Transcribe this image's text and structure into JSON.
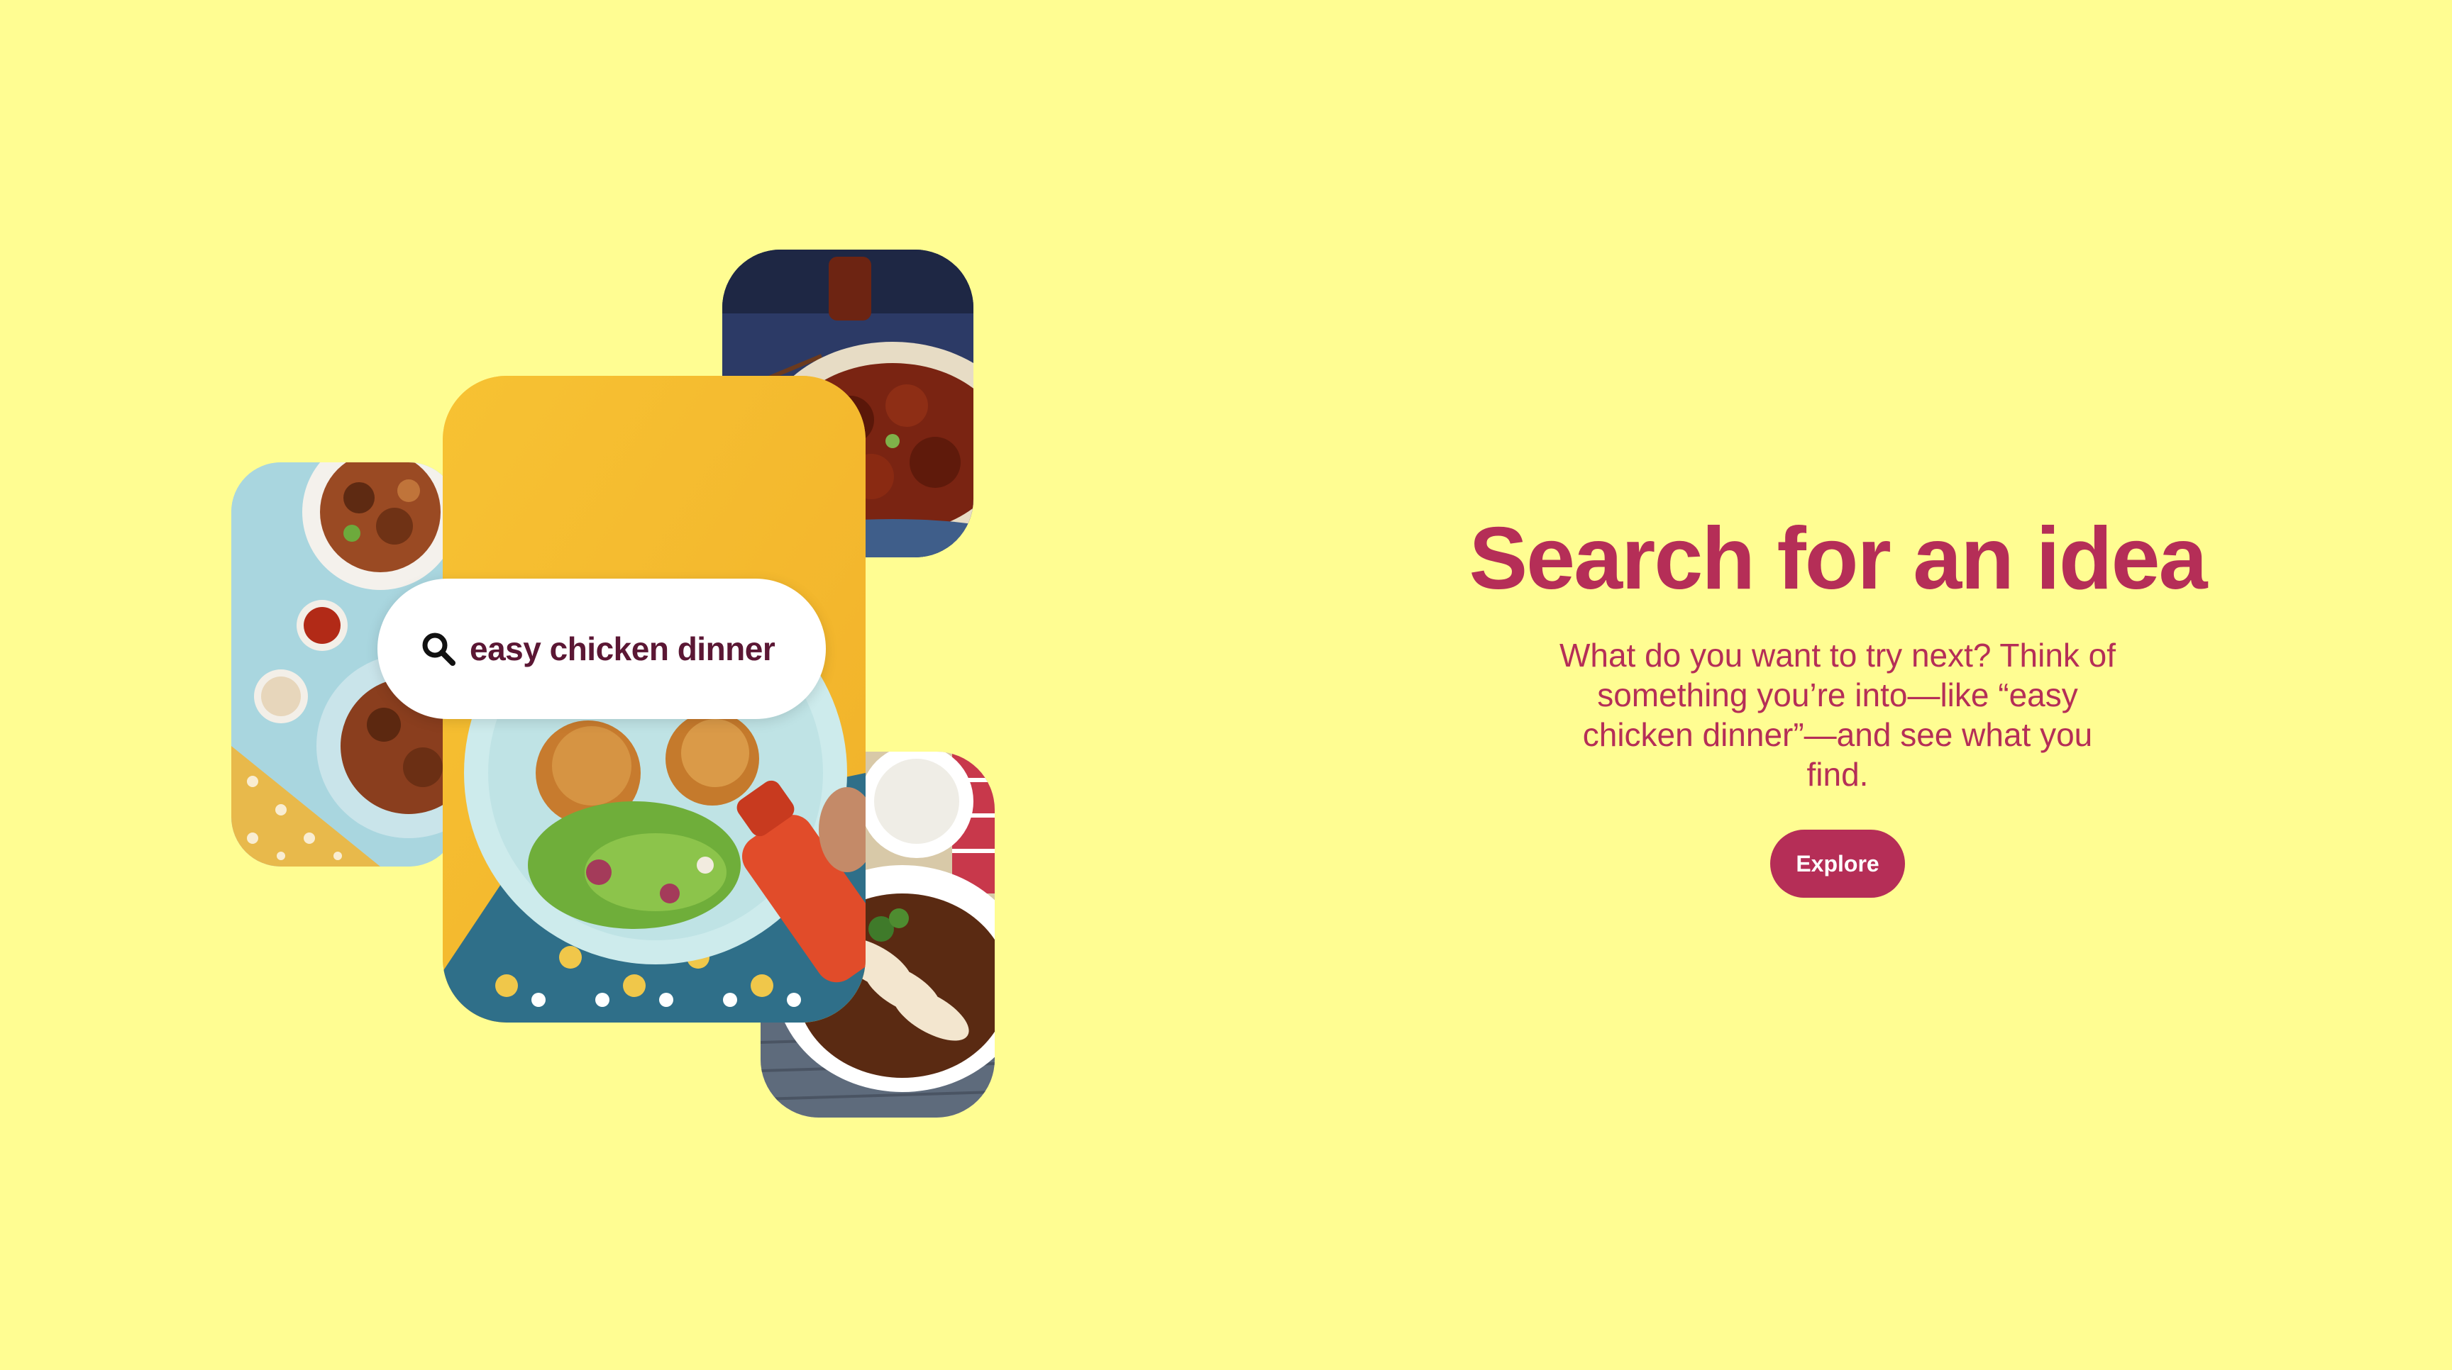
{
  "search": {
    "query": "easy chicken dinner"
  },
  "hero": {
    "title": "Search for an idea",
    "subtitle": "What do you want to try next? Think of something you’re into—like “easy chicken dinner”—and see what you find.",
    "explore_label": "Explore"
  },
  "colors": {
    "background": "#FFFD92",
    "accent": "#B52E57",
    "search_text": "#5B1734"
  },
  "icons": {
    "search": "search-icon"
  }
}
